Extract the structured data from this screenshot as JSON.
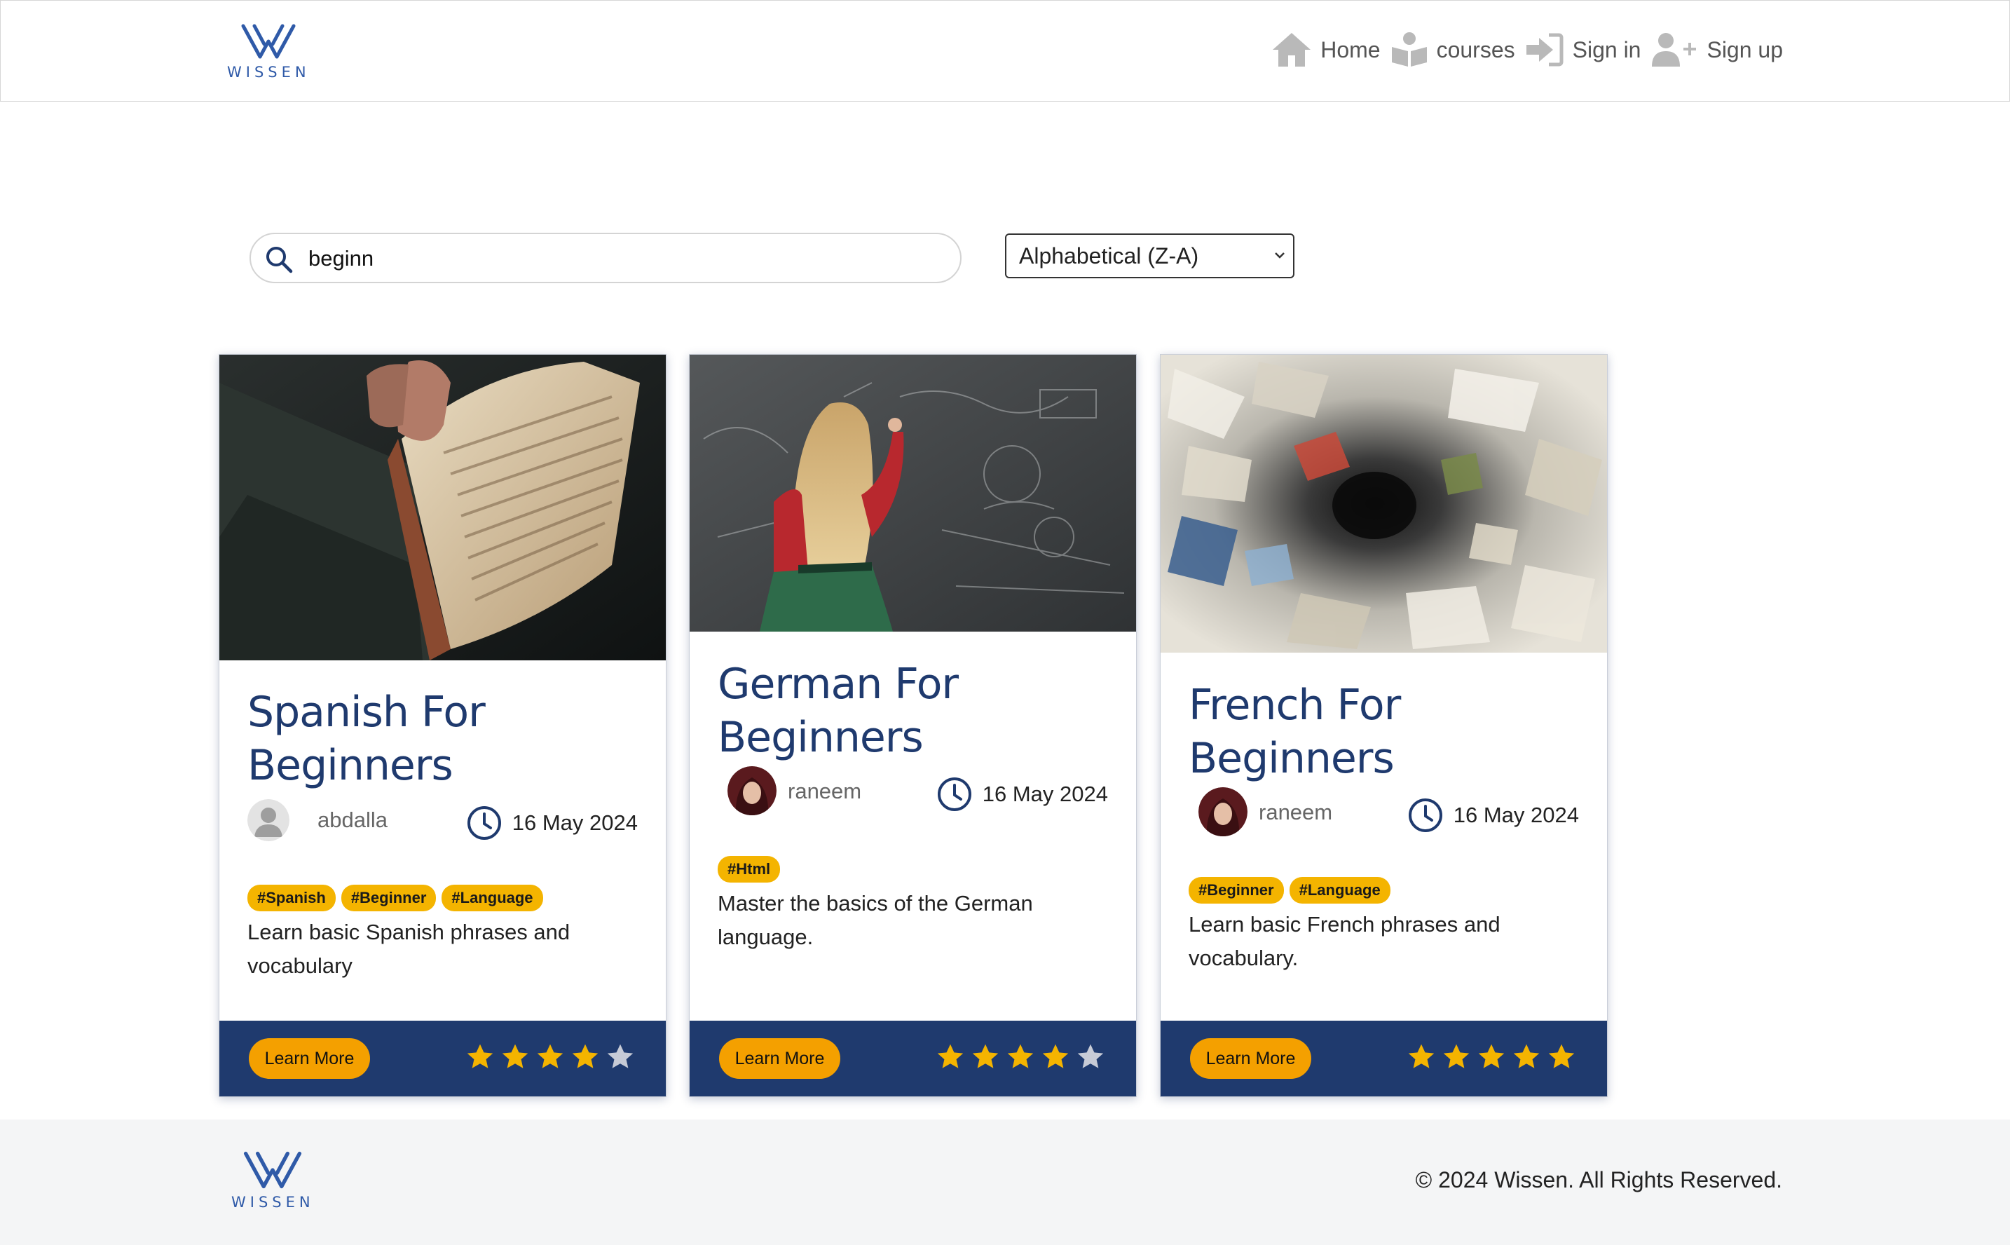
{
  "brand": {
    "name": "WISSEN"
  },
  "nav": {
    "items": [
      {
        "label": "Home",
        "icon": "home-icon"
      },
      {
        "label": "courses",
        "icon": "courses-icon"
      },
      {
        "label": "Sign in",
        "icon": "sign-in-icon"
      },
      {
        "label": "Sign up",
        "icon": "user-plus-icon"
      }
    ]
  },
  "search": {
    "value": "beginn",
    "icon": "search-icon"
  },
  "sort": {
    "selected": "Alphabetical (Z-A)",
    "icon": "chevron-down-icon"
  },
  "cards": [
    {
      "title": "Spanish For Beginners",
      "author": "abdalla",
      "avatar": "default-avatar",
      "date": "16 May 2024",
      "tags": [
        "#Spanish",
        "#Beginner",
        "#Language"
      ],
      "description": "Learn basic Spanish phrases and vocabulary",
      "button": "Learn More",
      "rating": 4,
      "max_rating": 5,
      "image": "person-holding-book-photo"
    },
    {
      "title": "German For Beginners",
      "author": "raneem",
      "avatar": "user-photo",
      "date": "16 May 2024",
      "tags": [
        "#Html"
      ],
      "description": "Master the basics of the German language.",
      "button": "Learn More",
      "rating": 4,
      "max_rating": 5,
      "image": "girl-at-chalkboard-photo"
    },
    {
      "title": "French For Beginners",
      "author": "raneem",
      "avatar": "user-photo",
      "date": "16 May 2024",
      "tags": [
        "#Beginner",
        "#Language"
      ],
      "description": "Learn basic French phrases and vocabulary.",
      "button": "Learn More",
      "rating": 5,
      "max_rating": 5,
      "image": "book-vortex-photo"
    }
  ],
  "footer": {
    "copyright": "© 2024 Wissen. All Rights Reserved."
  },
  "colors": {
    "primary": "#1f3a6e",
    "accent": "#f4b400",
    "button": "#f4a000",
    "star_filled": "#f4b400",
    "star_empty": "#c7cbd6",
    "footer_bg": "#f4f5f6"
  }
}
